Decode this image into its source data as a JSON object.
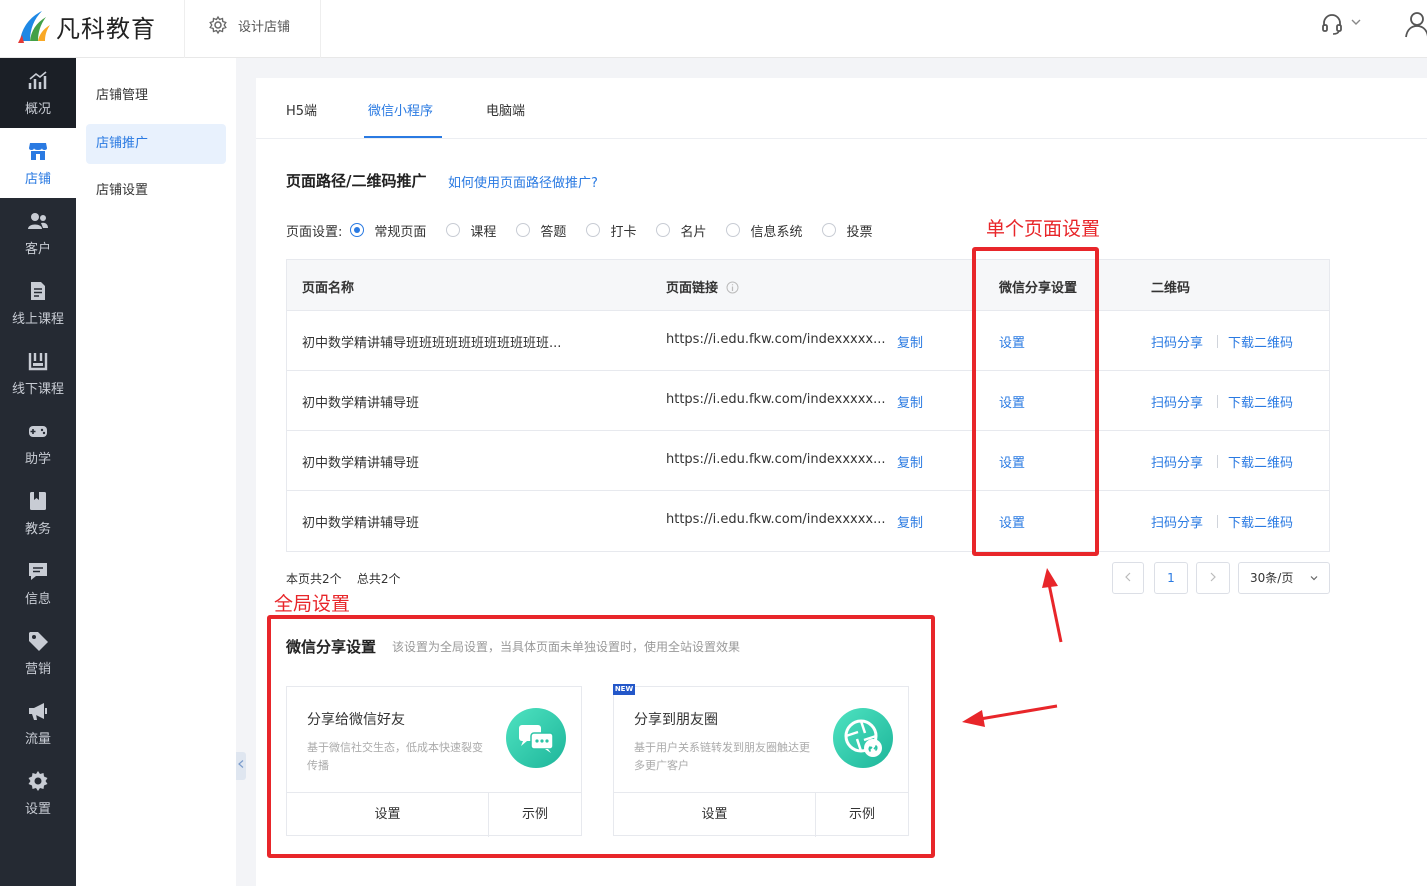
{
  "brand": {
    "name": "凡科教育"
  },
  "header": {
    "design_store": "设计店铺"
  },
  "nav": {
    "items": [
      {
        "label": "概况",
        "icon": "chart-icon"
      },
      {
        "label": "店铺",
        "icon": "store-icon"
      },
      {
        "label": "客户",
        "icon": "users-icon"
      },
      {
        "label": "线上课程",
        "icon": "document-icon"
      },
      {
        "label": "线下课程",
        "icon": "calendar-icon"
      },
      {
        "label": "助学",
        "icon": "gamepad-icon"
      },
      {
        "label": "教务",
        "icon": "book-icon"
      },
      {
        "label": "信息",
        "icon": "message-icon"
      },
      {
        "label": "营销",
        "icon": "tag-icon"
      },
      {
        "label": "流量",
        "icon": "megaphone-icon"
      },
      {
        "label": "设置",
        "icon": "gear-icon"
      }
    ],
    "active": "店铺"
  },
  "subnav": {
    "items": [
      {
        "label": "店铺管理"
      },
      {
        "label": "店铺推广"
      },
      {
        "label": "店铺设置"
      }
    ],
    "active": "店铺推广"
  },
  "tabs": [
    {
      "label": "H5端"
    },
    {
      "label": "微信小程序"
    },
    {
      "label": "电脑端"
    }
  ],
  "active_tab": "微信小程序",
  "section": {
    "title": "页面路径/二维码推广",
    "help_link": "如何使用页面路径做推广?"
  },
  "page_settings": {
    "label": "页面设置:",
    "options": [
      "常规页面",
      "课程",
      "答题",
      "打卡",
      "名片",
      "信息系统",
      "投票"
    ],
    "selected": "常规页面"
  },
  "table": {
    "headers": {
      "name": "页面名称",
      "link": "页面链接",
      "share": "微信分享设置",
      "qrcode": "二维码"
    },
    "rows": [
      {
        "name": "初中数学精讲辅导班班班班班班班班班班班...",
        "link": "https://i.edu.fkw.com/indexxxxx...",
        "copy": "复制",
        "share": "设置",
        "scan": "扫码分享",
        "download": "下载二维码"
      },
      {
        "name": "初中数学精讲辅导班",
        "link": "https://i.edu.fkw.com/indexxxxx...",
        "copy": "复制",
        "share": "设置",
        "scan": "扫码分享",
        "download": "下载二维码"
      },
      {
        "name": "初中数学精讲辅导班",
        "link": "https://i.edu.fkw.com/indexxxxx...",
        "copy": "复制",
        "share": "设置",
        "scan": "扫码分享",
        "download": "下载二维码"
      },
      {
        "name": "初中数学精讲辅导班",
        "link": "https://i.edu.fkw.com/indexxxxx...",
        "copy": "复制",
        "share": "设置",
        "scan": "扫码分享",
        "download": "下载二维码"
      }
    ]
  },
  "pagination": {
    "page_count_text": "本页共2个",
    "total_text": "总共2个",
    "current": "1",
    "page_size": "30条/页"
  },
  "global_share": {
    "title": "微信分享设置",
    "desc": "该设置为全局设置，当具体页面未单独设置时，使用全站设置效果",
    "cards": [
      {
        "title": "分享给微信好友",
        "desc": "基于微信社交生态，低成本快速裂变传播",
        "set": "设置",
        "example": "示例",
        "icon": "wechat-chat-icon"
      },
      {
        "title": "分享到朋友圈",
        "desc": "基于用户关系链转发到朋友圈触达更多更广客户",
        "set": "设置",
        "example": "示例",
        "badge": "NEW",
        "icon": "moments-icon"
      }
    ]
  },
  "annotations": {
    "single_page": "单个页面设置",
    "global": "全局设置",
    "color": "#e8262a"
  },
  "colors": {
    "accent": "#2a7ae2",
    "nav_bg": "#252a33"
  }
}
